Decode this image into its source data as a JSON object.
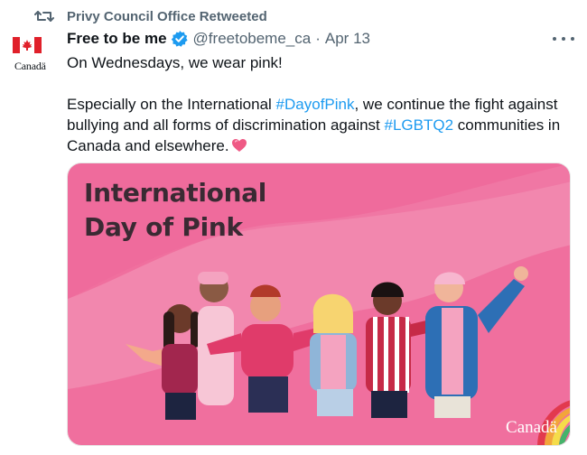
{
  "retweet": {
    "icon": "retweet-icon",
    "text": "Privy Council Office Retweeted"
  },
  "author": {
    "avatar_icon": "canada-flag-icon",
    "avatar_wordmark": "Canadä",
    "name": "Free to be me",
    "verified_icon": "verified-badge-icon",
    "handle": "@freetobeme_ca",
    "separator": "·",
    "date": "Apr 13"
  },
  "more_icon": "more-options-icon",
  "tweet": {
    "line1": "On Wednesdays, we wear pink!",
    "p2_a": "Especially on the International ",
    "hashtag1": "#DayofPink",
    "p2_b": ", we continue the fight against bullying and all forms of discrimination against ",
    "hashtag2": "#LGBTQ2",
    "p2_c": " communities in Canada and elsewhere.",
    "emoji_icon": "pink-heart-icon"
  },
  "media": {
    "title_line1": "International",
    "title_line2": "Day of Pink",
    "logo": "Canadä",
    "colors": {
      "background": "#f06f9e",
      "wave": "#f38fb3"
    }
  },
  "colors": {
    "link": "#1d9bf0",
    "secondary": "#536471",
    "verified": "#1d9bf0"
  }
}
